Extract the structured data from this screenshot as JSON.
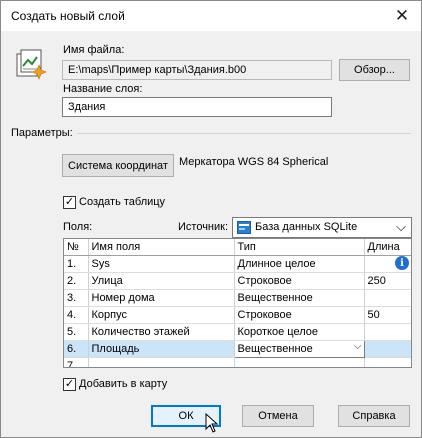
{
  "window": {
    "title": "Создать новый слой"
  },
  "file": {
    "label": "Имя файла:",
    "path": "E:\\maps\\Пример карты\\Здания.b00",
    "browse_label": "Обзор..."
  },
  "layer": {
    "label": "Название слоя:",
    "value": "Здания"
  },
  "params": {
    "label": "Параметры:"
  },
  "coords": {
    "button_label": "Система координат",
    "value": "Меркатора WGS 84 Spherical"
  },
  "create_table": {
    "label": "Создать таблицу",
    "checked": true
  },
  "fields": {
    "label": "Поля:",
    "source_label": "Источник:",
    "source_value": "База данных SQLite",
    "source_icon": "database-icon"
  },
  "table": {
    "columns": [
      "№",
      "Имя поля",
      "Тип",
      "Длина"
    ],
    "rows": [
      {
        "n": "1.",
        "name": "Sys",
        "type": "Длинное целое",
        "len": ""
      },
      {
        "n": "2.",
        "name": "Улица",
        "type": "Строковое",
        "len": "250"
      },
      {
        "n": "3.",
        "name": "Номер дома",
        "type": "Вещественное",
        "len": ""
      },
      {
        "n": "4.",
        "name": "Корпус",
        "type": "Строковое",
        "len": "50"
      },
      {
        "n": "5.",
        "name": "Количество этажей",
        "type": "Короткое целое",
        "len": ""
      },
      {
        "n": "6.",
        "name": "Площадь",
        "type": "Вещественное",
        "len": ""
      },
      {
        "n": "7.",
        "name": "",
        "type": "",
        "len": ""
      }
    ]
  },
  "add_to_map": {
    "label": "Добавить в карту",
    "checked": true
  },
  "buttons": {
    "ok": "ОК",
    "cancel": "Отмена",
    "help": "Справка"
  },
  "colors": {
    "accent": "#0078d7",
    "selection": "#cce4f7",
    "info": "#1e6fd0"
  }
}
